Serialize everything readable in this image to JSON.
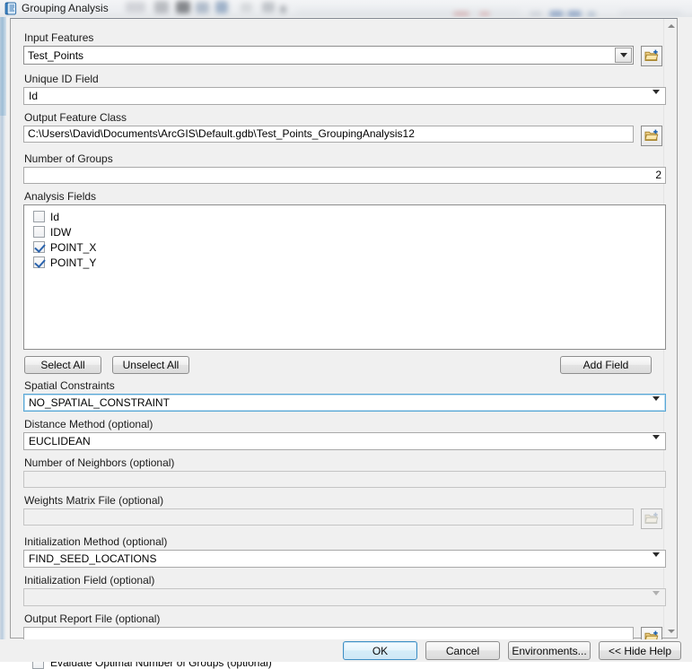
{
  "window": {
    "title": "Grouping Analysis",
    "icon": "script-tool-icon"
  },
  "fields": {
    "input_features": {
      "label": "Input Features",
      "value": "Test_Points",
      "browse_icon": "folder-add-icon"
    },
    "unique_id_field": {
      "label": "Unique ID Field",
      "value": "Id"
    },
    "output_feature_class": {
      "label": "Output Feature Class",
      "value": "C:\\Users\\David\\Documents\\ArcGIS\\Default.gdb\\Test_Points_GroupingAnalysis12",
      "browse_icon": "folder-add-icon"
    },
    "number_of_groups": {
      "label": "Number of Groups",
      "value": "2"
    },
    "analysis_fields": {
      "label": "Analysis Fields",
      "items": [
        {
          "name": "Id",
          "checked": false
        },
        {
          "name": "IDW",
          "checked": false
        },
        {
          "name": "POINT_X",
          "checked": true
        },
        {
          "name": "POINT_Y",
          "checked": true
        }
      ]
    },
    "spatial_constraints": {
      "label": "Spatial Constraints",
      "value": "NO_SPATIAL_CONSTRAINT"
    },
    "distance_method": {
      "label": "Distance Method (optional)",
      "value": "EUCLIDEAN"
    },
    "number_of_neighbors": {
      "label": "Number of Neighbors (optional)",
      "value": ""
    },
    "weights_matrix_file": {
      "label": "Weights Matrix File (optional)",
      "value": "",
      "browse_icon": "folder-add-icon"
    },
    "initialization_method": {
      "label": "Initialization Method (optional)",
      "value": "FIND_SEED_LOCATIONS"
    },
    "initialization_field": {
      "label": "Initialization Field (optional)",
      "value": ""
    },
    "output_report_file": {
      "label": "Output Report File (optional)",
      "value": "",
      "browse_icon": "folder-add-icon"
    },
    "evaluate_optimal": {
      "label": "Evaluate Optimal Number of Groups (optional)",
      "checked": false
    }
  },
  "buttons": {
    "select_all": "Select All",
    "unselect_all": "Unselect All",
    "add_field": "Add Field",
    "ok": "OK",
    "cancel": "Cancel",
    "environments": "Environments...",
    "hide_help": "<< Hide Help"
  },
  "scrollbar": {
    "up_icon": "scroll-up-arrow-icon",
    "down_icon": "scroll-down-arrow-icon"
  },
  "colors": {
    "dialog_bg": "#f0f0f0",
    "field_bg": "#ffffff",
    "disabled_bg": "#f0f0f0",
    "focus_accent": "#5aa8d6",
    "check_accent": "#2a63ad",
    "folder_icon": "#e8c46a"
  }
}
